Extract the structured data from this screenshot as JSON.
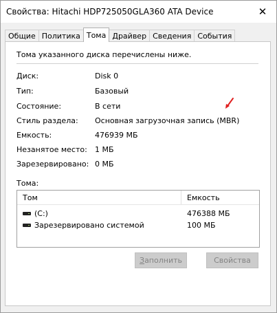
{
  "window": {
    "title": "Свойства: Hitachi HDP725050GLA360 ATA Device",
    "close_glyph": "✕"
  },
  "tabs": [
    {
      "label": "Общие",
      "active": false
    },
    {
      "label": "Политика",
      "active": false
    },
    {
      "label": "Тома",
      "active": true
    },
    {
      "label": "Драйвер",
      "active": false
    },
    {
      "label": "Сведения",
      "active": false
    },
    {
      "label": "События",
      "active": false
    }
  ],
  "intro_text": "Тома указанного диска перечислены ниже.",
  "properties": [
    {
      "label": "Диск:",
      "value": "Disk 0"
    },
    {
      "label": "Тип:",
      "value": "Базовый"
    },
    {
      "label": "Состояние:",
      "value": "В сети"
    },
    {
      "label": "Стиль раздела:",
      "value": "Основная загрузочная запись (MBR)"
    },
    {
      "label": "Емкость:",
      "value": "476939 МБ"
    },
    {
      "label": "Незанятое место:",
      "value": "1 МБ"
    },
    {
      "label": "Зарезервировано:",
      "value": "0 МБ"
    }
  ],
  "volumes": {
    "label": "Тома:",
    "columns": [
      "Том",
      "Емкость"
    ],
    "rows": [
      {
        "name": "(C:)",
        "size": "476388 МБ",
        "icon": "drive-icon"
      },
      {
        "name": "Зарезервировано системой",
        "size": "100 МБ",
        "icon": "drive-icon"
      }
    ]
  },
  "buttons": {
    "populate_mnemonic": "З",
    "populate_rest": "аполнить",
    "properties": "Свойства"
  },
  "colors": {
    "annotation_arrow": "#e02020",
    "disabled_button_bg": "#cccccc",
    "disabled_text": "#838383"
  }
}
